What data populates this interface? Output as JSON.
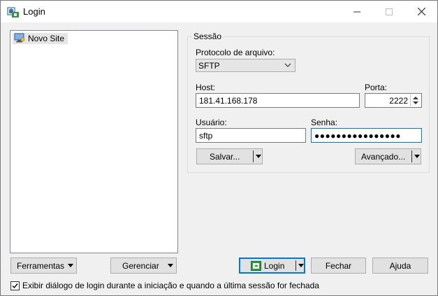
{
  "window": {
    "title": "Login",
    "icon": "winscp-app-icon"
  },
  "controls": {
    "minimize": "minimize-icon",
    "maximize": "maximize-icon",
    "close": "close-icon"
  },
  "tree": {
    "items": [
      {
        "label": "Novo Site",
        "icon": "computer-icon"
      }
    ]
  },
  "session": {
    "group_label": "Sessão",
    "protocol_label": "Protocolo de arquivo:",
    "protocol_value": "SFTP",
    "host_label": "Host:",
    "host_value": "181.41.168.178",
    "port_label": "Porta:",
    "port_value": "2222",
    "user_label": "Usuário:",
    "user_value": "sftp",
    "password_label": "Senha:",
    "password_mask": "●●●●●●●●●●●●●●●●",
    "save_label": "Salvar...",
    "advanced_label": "Avançado..."
  },
  "footer": {
    "tools_label": "Ferramentas",
    "manage_label": "Gerenciar",
    "login_label": "Login",
    "close_label": "Fechar",
    "help_label": "Ajuda",
    "checkbox_label": "Exibir diálogo de login durante a iniciação e quando a última sessão for fechada",
    "checkbox_checked": true
  },
  "colors": {
    "focus_accent": "#0078d7",
    "login_icon_green": "#2a9d3a"
  }
}
